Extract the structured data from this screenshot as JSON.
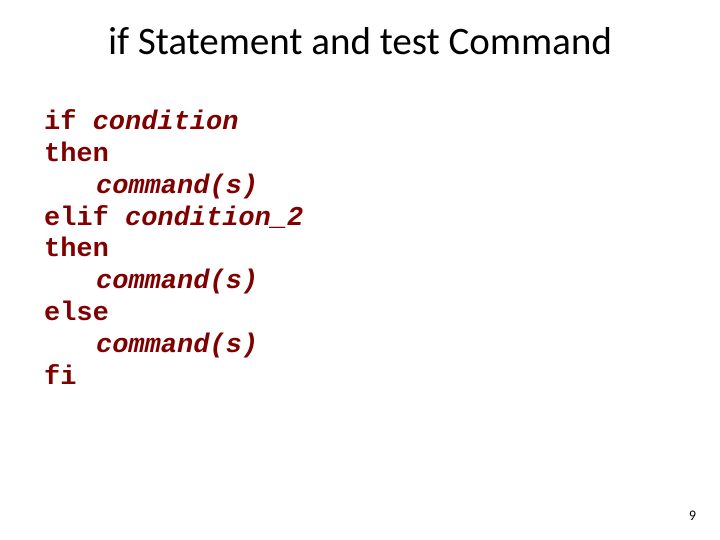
{
  "title": "if Statement and test Command",
  "code": {
    "l1_if": "if ",
    "l1_condition": "condition",
    "l2_then": "then",
    "l3_commands": "command(s)",
    "l4_elif": "elif ",
    "l4_condition": "condition_2",
    "l5_then": "then",
    "l6_commands": "command(s)",
    "l7_else": "else",
    "l8_commands": "command(s)",
    "l9_fi": "fi"
  },
  "page_number": "9"
}
